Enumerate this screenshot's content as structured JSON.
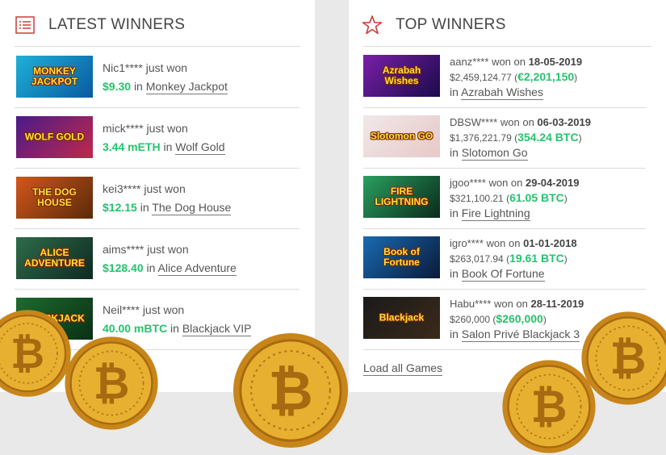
{
  "latest": {
    "title": "LATEST WINNERS",
    "icon": "list-icon",
    "items": [
      {
        "user": "Nic1****",
        "action": "just won",
        "amount": "$9.30",
        "in": "in",
        "game": "Monkey Jackpot",
        "thumb_text": "MONKEY JACKPOT",
        "thumb_colors": [
          "#1fb0d8",
          "#0a5aa0"
        ]
      },
      {
        "user": "mick****",
        "action": "just won",
        "amount": "3.44 mETH",
        "in": "in",
        "game": "Wolf Gold",
        "thumb_text": "WOLF GOLD",
        "thumb_colors": [
          "#4a1a8a",
          "#c0284a"
        ]
      },
      {
        "user": "kei3****",
        "action": "just won",
        "amount": "$12.15",
        "in": "in",
        "game": "The Dog House",
        "thumb_text": "THE DOG HOUSE",
        "thumb_colors": [
          "#d2571a",
          "#5a2a0a"
        ]
      },
      {
        "user": "aims****",
        "action": "just won",
        "amount": "$128.40",
        "in": "in",
        "game": "Alice Adventure",
        "thumb_text": "ALICE ADVENTURE",
        "thumb_colors": [
          "#2e6b4a",
          "#0f2a22"
        ]
      },
      {
        "user": "Neil****",
        "action": "just won",
        "amount": "40.00 mBTC",
        "in": "in",
        "game": "Blackjack VIP",
        "thumb_text": "BLACKJACK",
        "thumb_colors": [
          "#1e6b2e",
          "#0a3016"
        ]
      }
    ]
  },
  "top": {
    "title": "TOP WINNERS",
    "icon": "star-icon",
    "won_on": "won on",
    "in": "in",
    "items": [
      {
        "user": "aanz****",
        "date": "18-05-2019",
        "usd": "$2,459,124.77",
        "amount": "€2,201,150",
        "game": "Azrabah Wishes",
        "thumb_text": "Azrabah Wishes",
        "thumb_colors": [
          "#7a1fa8",
          "#1a0a4a"
        ]
      },
      {
        "user": "DBSW****",
        "date": "06-03-2019",
        "usd": "$1,376,221.79",
        "amount": "354.24 BTC",
        "game": "Slotomon Go",
        "thumb_text": "Slotomon GO",
        "thumb_colors": [
          "#f0e8e8",
          "#e8c8c8"
        ]
      },
      {
        "user": "jgoo****",
        "date": "29-04-2019",
        "usd": "$321,100.21",
        "amount": "61.05 BTC",
        "game": "Fire Lightning",
        "thumb_text": "FIRE LIGHTNING",
        "thumb_colors": [
          "#2aa060",
          "#0a2a1a"
        ]
      },
      {
        "user": "igro****",
        "date": "01-01-2018",
        "usd": "$263,017.94",
        "amount": "19.61 BTC",
        "game": "Book Of Fortune",
        "thumb_text": "Book of Fortune",
        "thumb_colors": [
          "#1a6ab0",
          "#0a1a3a"
        ]
      },
      {
        "user": "Habu****",
        "date": "28-11-2019",
        "usd": "$260,000",
        "amount": "$260,000",
        "game": "Salon Privé Blackjack 3",
        "thumb_text": "Blackjack",
        "thumb_colors": [
          "#1a1a1a",
          "#3a2a1a"
        ]
      }
    ],
    "load_all": "Load all Games"
  },
  "colors": {
    "accent_red": "#d23a3a",
    "win_green": "#25c36d",
    "coin_gold": "#e0a21c"
  }
}
